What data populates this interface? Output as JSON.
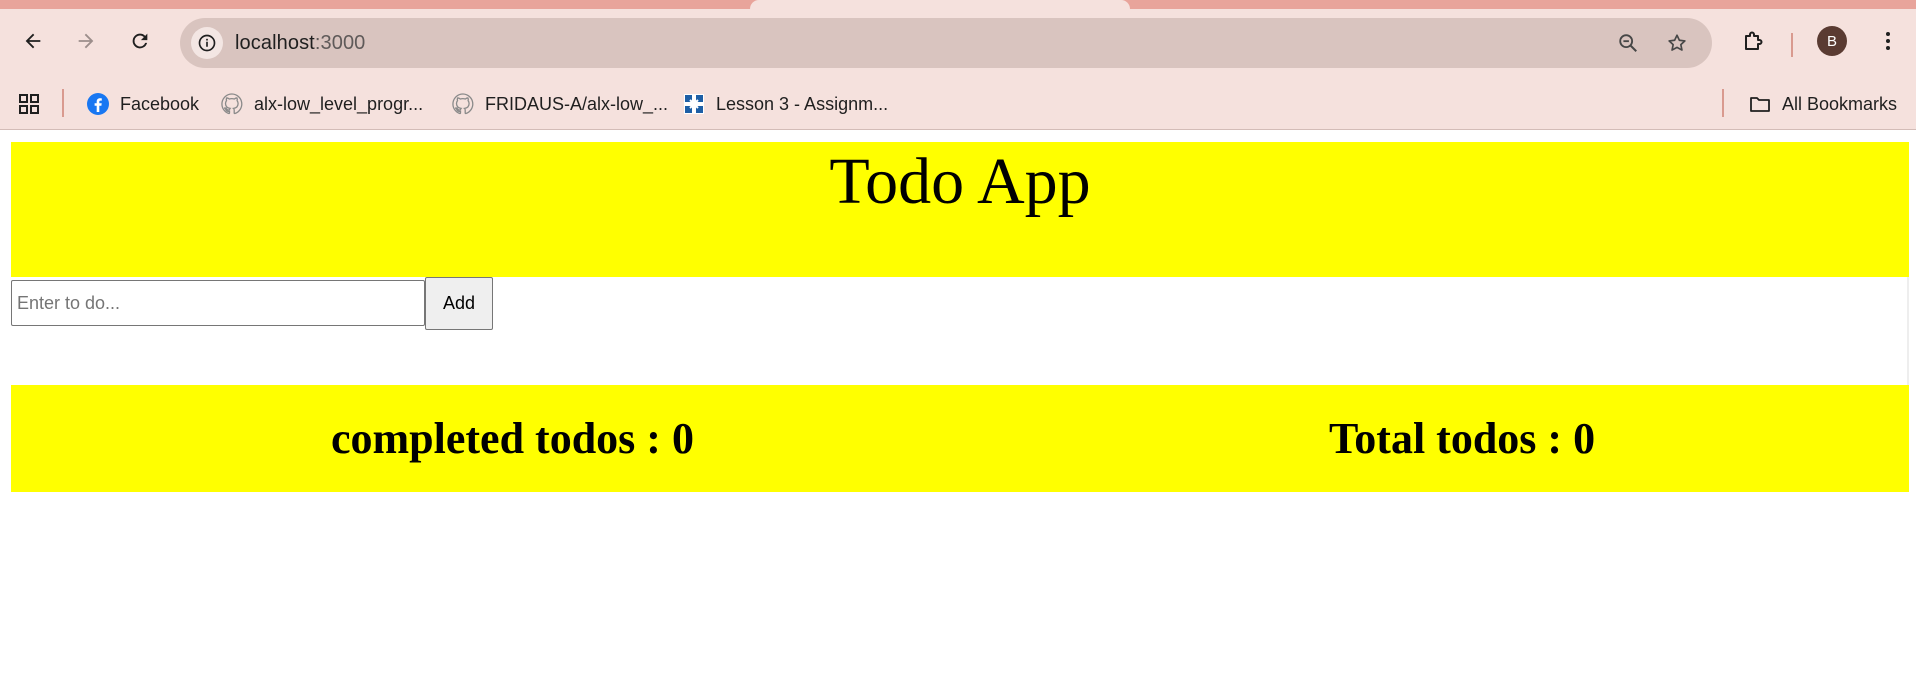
{
  "browser": {
    "url_host": "localhost",
    "url_port": ":3000",
    "profile_initial": "B",
    "bookmarks": [
      {
        "label": "Facebook",
        "icon": "facebook-icon"
      },
      {
        "label": "alx-low_level_progr...",
        "icon": "github-icon"
      },
      {
        "label": "FRIDAUS-A/alx-low_...",
        "icon": "github-icon"
      },
      {
        "label": "Lesson 3 - Assignm...",
        "icon": "lesson-site-icon"
      }
    ],
    "all_bookmarks_label": "All Bookmarks"
  },
  "app": {
    "title": "Todo App",
    "input_placeholder": "Enter to do...",
    "input_value": "",
    "add_label": "Add",
    "completed_text": "completed todos : 0",
    "total_text": "Total todos : 0"
  },
  "colors": {
    "banner": "#ffff00",
    "chrome": "#f5e1dd",
    "omnibox": "#d9c4bf"
  }
}
